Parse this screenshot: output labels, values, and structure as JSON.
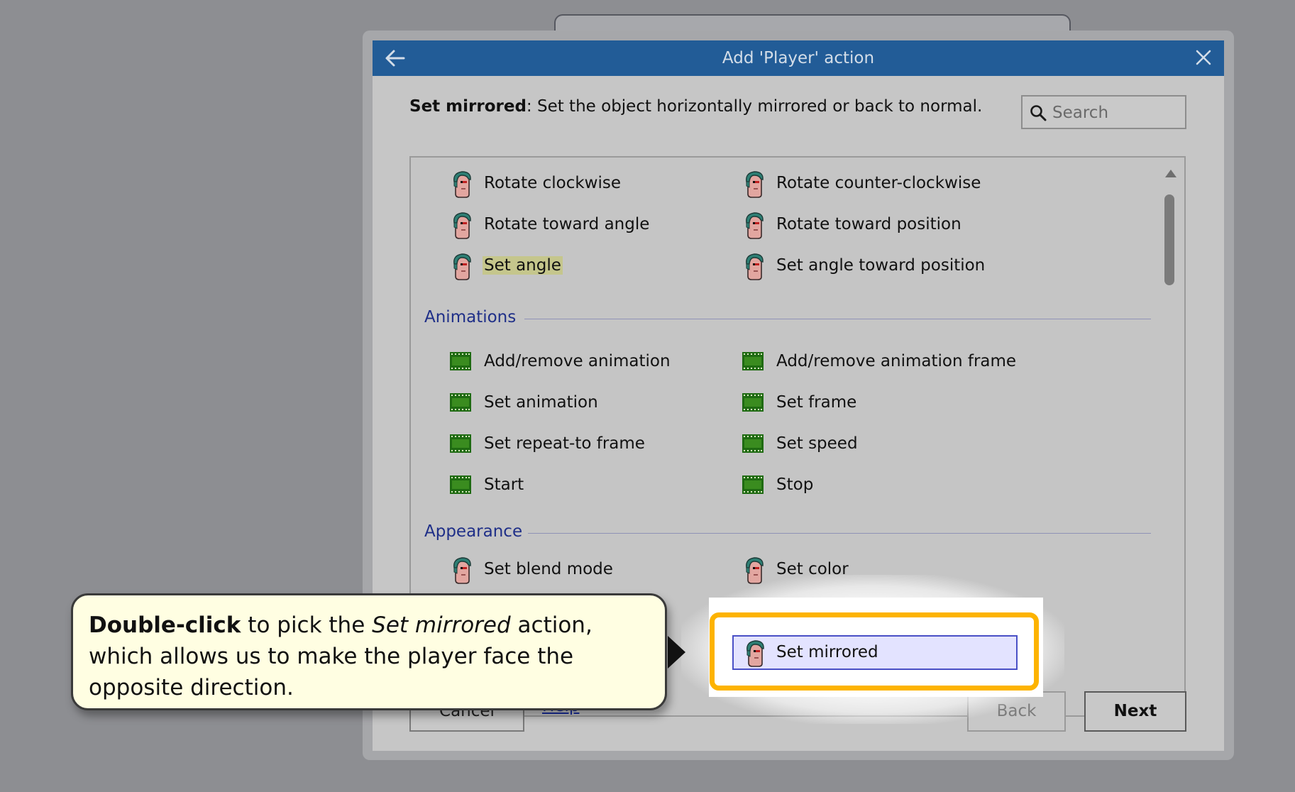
{
  "dialog": {
    "title": "Add 'Player' action",
    "description_title": "Set mirrored",
    "description_text": ": Set the object horizontally mirrored or back to normal.",
    "search_placeholder": "Search"
  },
  "list": {
    "top_items": [
      {
        "label": "Rotate clockwise",
        "icon": "player-head-icon"
      },
      {
        "label": "Rotate counter-clockwise",
        "icon": "player-head-icon"
      },
      {
        "label": "Rotate toward angle",
        "icon": "player-head-icon"
      },
      {
        "label": "Rotate toward position",
        "icon": "player-head-icon"
      },
      {
        "label": "Set angle",
        "icon": "player-head-icon",
        "highlighted": true
      },
      {
        "label": "Set angle toward position",
        "icon": "player-head-icon"
      }
    ],
    "animations": {
      "heading": "Animations",
      "items": [
        {
          "label": "Add/remove animation",
          "icon": "film-strip-icon"
        },
        {
          "label": "Add/remove animation frame",
          "icon": "film-strip-icon"
        },
        {
          "label": "Set animation",
          "icon": "film-strip-icon"
        },
        {
          "label": "Set frame",
          "icon": "film-strip-icon"
        },
        {
          "label": "Set repeat-to frame",
          "icon": "film-strip-icon"
        },
        {
          "label": "Set speed",
          "icon": "film-strip-icon"
        },
        {
          "label": "Start",
          "icon": "film-strip-icon"
        },
        {
          "label": "Stop",
          "icon": "film-strip-icon"
        }
      ]
    },
    "appearance": {
      "heading": "Appearance",
      "items": [
        {
          "label": "Set blend mode",
          "icon": "player-head-icon"
        },
        {
          "label": "Set color",
          "icon": "player-head-icon"
        }
      ],
      "selected_item": {
        "label": "Set mirrored",
        "icon": "player-head-icon"
      }
    }
  },
  "buttons": {
    "cancel": "Cancel",
    "help": "Help",
    "back": "Back",
    "next": "Next"
  },
  "callout": {
    "bold": "Double-click",
    "text1": " to pick the ",
    "italic": "Set mirrored",
    "text2": " action, which allows us to make the player face the opposite direction."
  },
  "colors": {
    "titlebar": "#225c97",
    "highlight_ring": "#fdb300",
    "selection_fill": "#e3e3ff",
    "group_heading": "#1f2f88",
    "callout_fill": "#fffee2"
  }
}
